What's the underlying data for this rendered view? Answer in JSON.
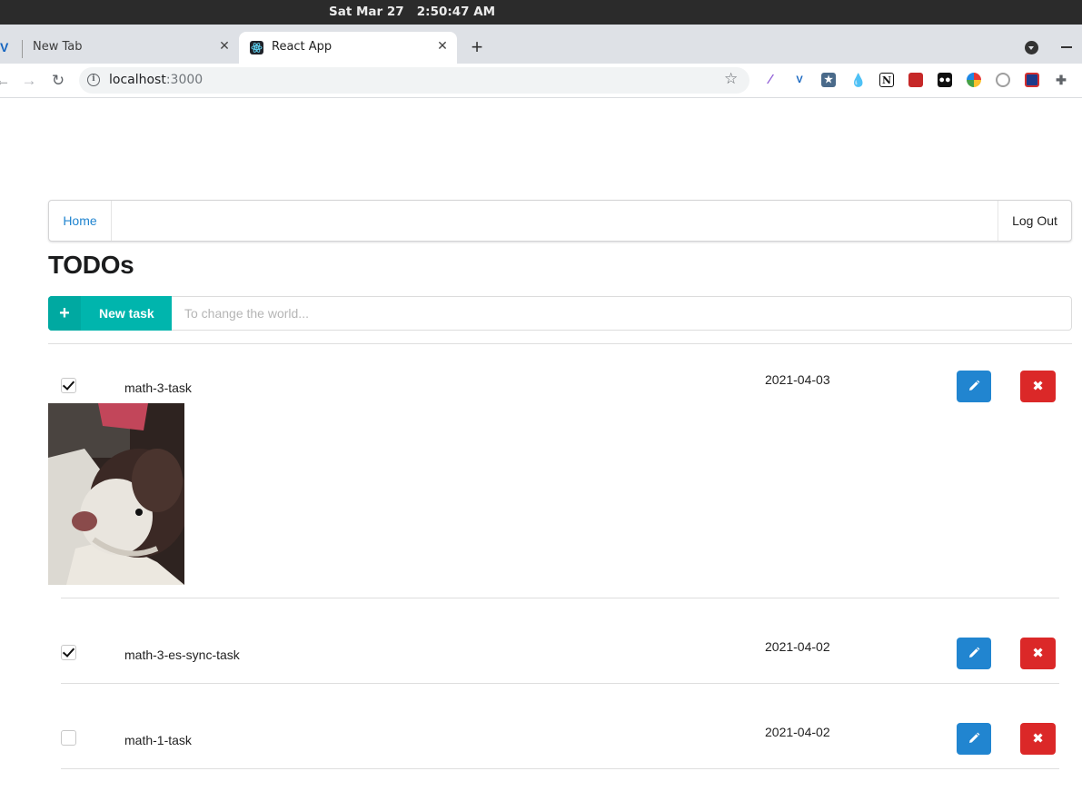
{
  "os": {
    "clock": "Sat Mar 27   2:50:47 AM"
  },
  "browser": {
    "tabs": [
      {
        "title": "New Tab",
        "active": false
      },
      {
        "title": "React App",
        "active": true
      }
    ],
    "url_host": "localhost",
    "url_port": ":3000",
    "extensions": [
      "feather-icon",
      "vuetify-icon",
      "star-box-icon",
      "drop-icon",
      "notion-icon",
      "book-icon",
      "rabbit-icon",
      "pinwheel-icon",
      "spiral-icon",
      "shield-icon",
      "puzzle-icon"
    ]
  },
  "app": {
    "nav": {
      "home": "Home",
      "logout": "Log Out"
    },
    "title": "TODOs",
    "new_task": {
      "label": "New task",
      "placeholder": "To change the world..."
    },
    "todos": [
      {
        "name": "math-3-task",
        "date": "2021-04-03",
        "done": true,
        "has_image": true
      },
      {
        "name": "math-3-es-sync-task",
        "date": "2021-04-02",
        "done": true,
        "has_image": false
      },
      {
        "name": "math-1-task",
        "date": "2021-04-02",
        "done": false,
        "has_image": false
      }
    ],
    "colors": {
      "teal": "#00b5ad",
      "blue": "#2185d0",
      "red": "#db2828"
    }
  }
}
